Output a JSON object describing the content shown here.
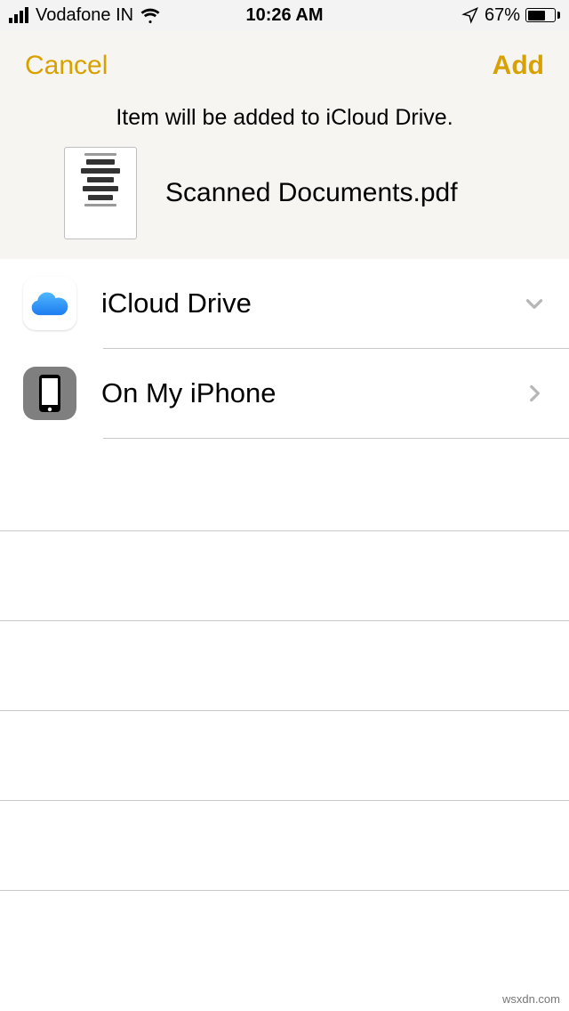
{
  "statusbar": {
    "carrier": "Vodafone IN",
    "time": "10:26 AM",
    "battery_pct": "67%"
  },
  "navbar": {
    "cancel": "Cancel",
    "add": "Add"
  },
  "info_text": "Item will be added to iCloud Drive.",
  "file": {
    "name": "Scanned Documents.pdf"
  },
  "locations": [
    {
      "id": "icloud",
      "label": "iCloud Drive",
      "expanded": true
    },
    {
      "id": "on-my-iphone",
      "label": "On My iPhone",
      "expanded": false
    }
  ],
  "watermark": "wsxdn.com"
}
